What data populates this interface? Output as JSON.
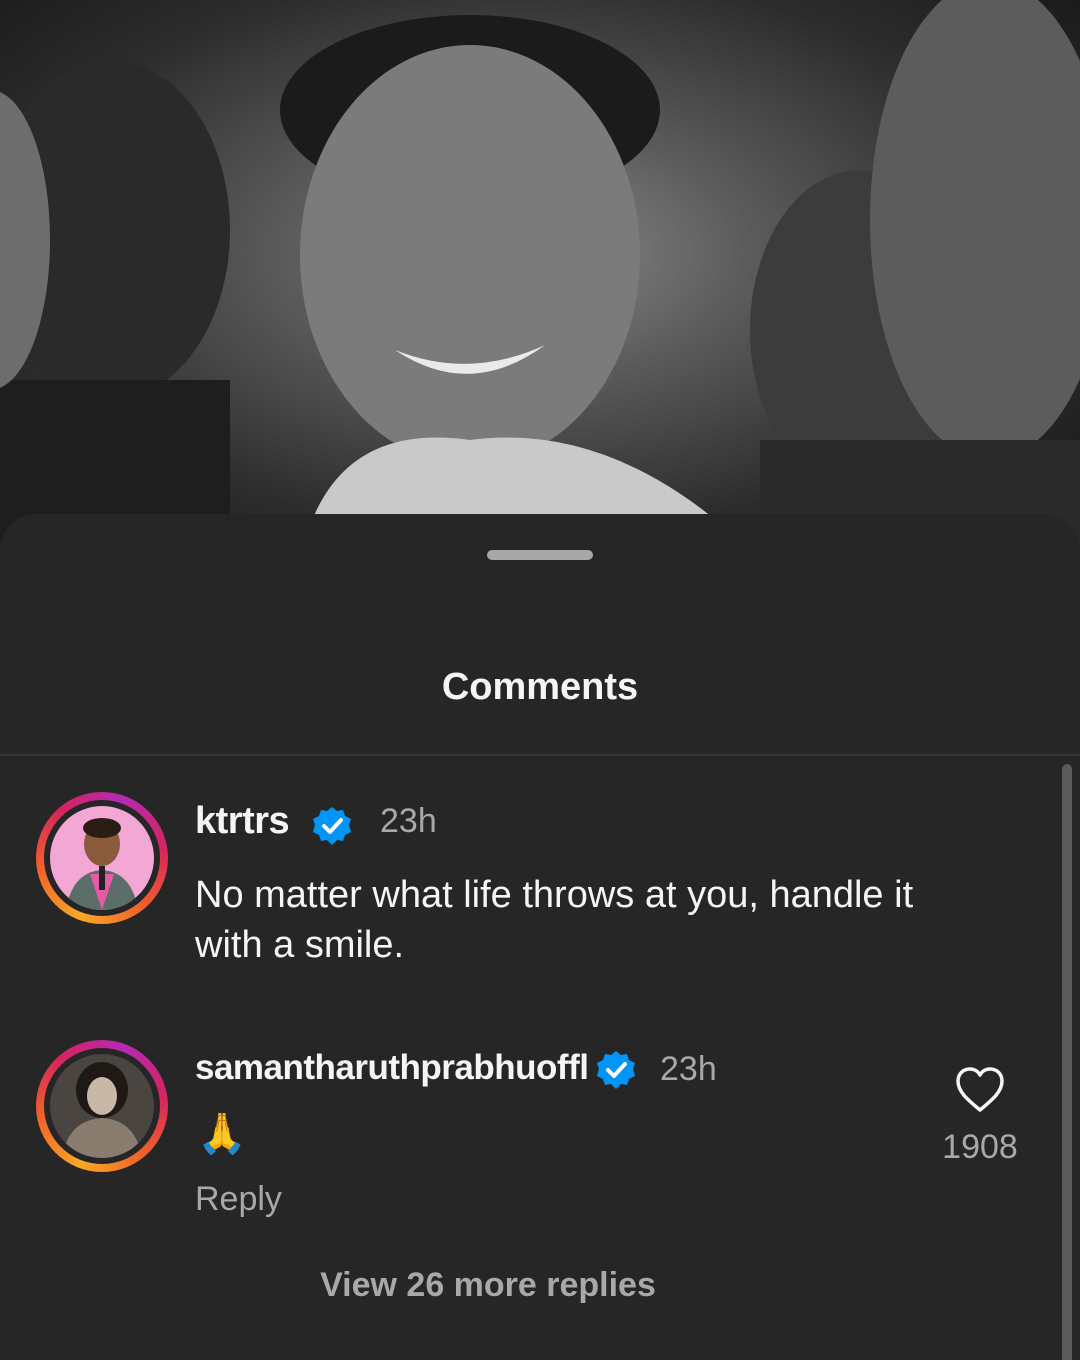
{
  "sheet": {
    "title": "Comments"
  },
  "comments": [
    {
      "username": "ktrtrs",
      "verified": true,
      "time": "23h",
      "text": "No matter what life throws at you, handle it with a smile."
    },
    {
      "username": "samantharuthprabhuoffl",
      "verified": true,
      "time": "23h",
      "text": "🙏",
      "reply_label": "Reply",
      "like_count": "1908"
    }
  ],
  "view_replies_label": "View 26 more replies",
  "colors": {
    "sheet_bg": "#262626",
    "verified_blue": "#0095f6",
    "text_primary": "#f5f5f5",
    "text_secondary": "#a8a8a8"
  },
  "icons": [
    "verified-badge-icon",
    "heart-icon"
  ]
}
